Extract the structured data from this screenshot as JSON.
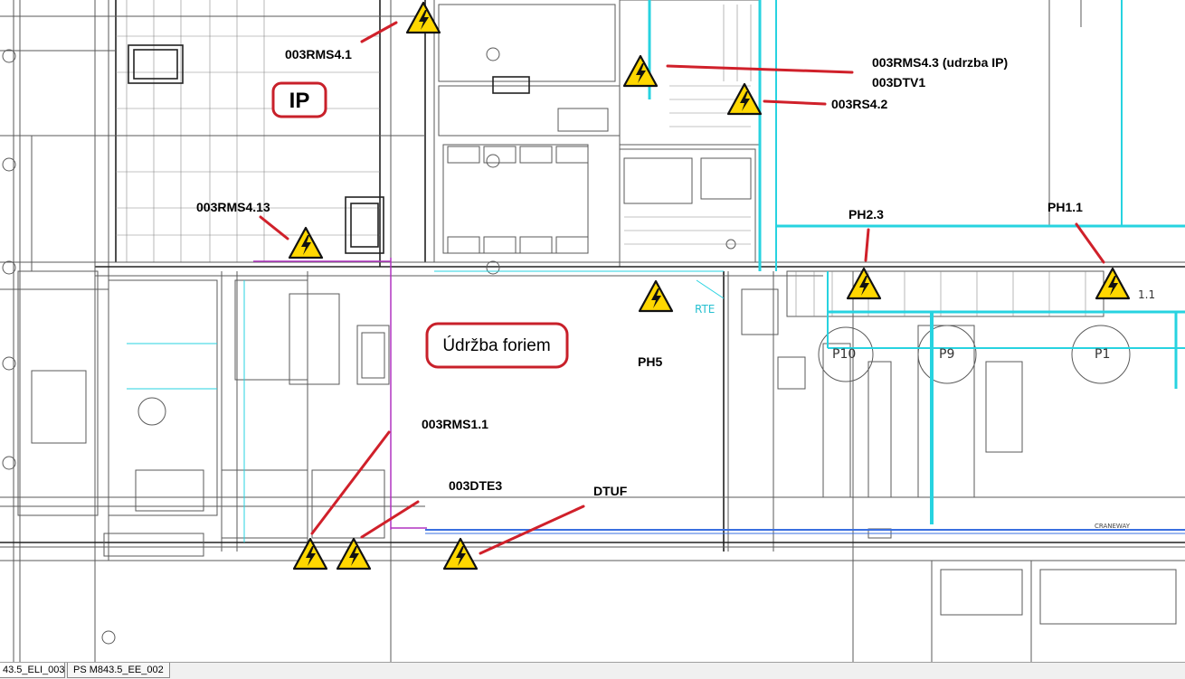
{
  "drawing": {
    "callouts": {
      "rms4_1": "003RMS4.1",
      "rms4_3": "003RMS4.3 (udrzba IP)",
      "dtv1": "003DTV1",
      "rs4_2": "003RS4.2",
      "rms4_13": "003RMS4.13",
      "ph2_3": "PH2.3",
      "ph1_1": "PH1.1",
      "ph5": "PH5",
      "rms1_1": "003RMS1.1",
      "dte3": "003DTE3",
      "dtuf": "DTUF"
    },
    "boxes": {
      "ip": "IP",
      "udrzba": "Údržba foriem"
    },
    "room_labels": {
      "p1": "P1",
      "p9": "P9",
      "p10": "P10",
      "craneway": "CRANEWAY",
      "r1_1": "1.1",
      "rt": "RTE"
    },
    "colors": {
      "callout_line": "#d0202a",
      "box_border": "#c8202a",
      "warning_fill": "#ffd700",
      "cyan": "#27d3e0",
      "blue": "#3a6fe0",
      "magenta": "#b033c0"
    }
  },
  "tabs": [
    {
      "label": "43.5_ELI_003"
    },
    {
      "label": "PS M843.5_EE_002"
    }
  ]
}
